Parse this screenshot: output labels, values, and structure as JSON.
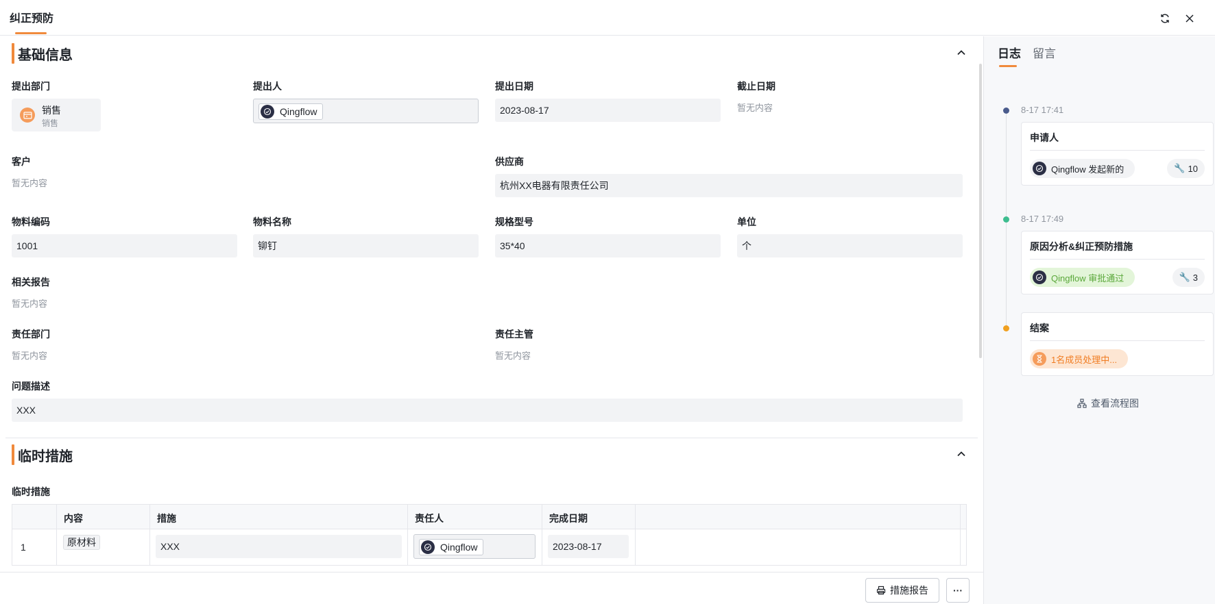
{
  "header": {
    "title": "纠正预防",
    "refresh_icon": "refresh-icon",
    "close_icon": "close-icon"
  },
  "sections": {
    "basic": {
      "title": "基础信息"
    },
    "temporary": {
      "title": "临时措施"
    }
  },
  "fields": {
    "dept": {
      "label": "提出部门",
      "name": "销售",
      "sub": "销售"
    },
    "proposer": {
      "label": "提出人",
      "value": "Qingflow"
    },
    "date": {
      "label": "提出日期",
      "value": "2023-08-17"
    },
    "deadline": {
      "label": "截止日期",
      "value": "暂无内容"
    },
    "customer": {
      "label": "客户",
      "value": "暂无内容"
    },
    "supplier": {
      "label": "供应商",
      "value": "杭州XX电器有限责任公司"
    },
    "material_code": {
      "label": "物料编码",
      "value": "1001"
    },
    "material_name": {
      "label": "物料名称",
      "value": "铆钉"
    },
    "spec": {
      "label": "规格型号",
      "value": "35*40"
    },
    "unit": {
      "label": "单位",
      "value": "个"
    },
    "report": {
      "label": "相关报告",
      "value": "暂无内容"
    },
    "resp_dept": {
      "label": "责任部门",
      "value": "暂无内容"
    },
    "resp_manager": {
      "label": "责任主管",
      "value": "暂无内容"
    },
    "problem": {
      "label": "问题描述",
      "value": "XXX"
    }
  },
  "measures_table": {
    "label": "临时措施",
    "headers": [
      "内容",
      "措施",
      "责任人",
      "完成日期"
    ],
    "rows": [
      {
        "index": "1",
        "content": "原材料",
        "measure": "XXX",
        "owner": "Qingflow",
        "date": "2023-08-17"
      }
    ]
  },
  "footer": {
    "report_button": "措施报告",
    "more_button": "···"
  },
  "right_panel": {
    "tabs": [
      "日志",
      "留言"
    ],
    "timeline": [
      {
        "time": "8-17 17:41",
        "title": "申请人",
        "actor": "Qingflow 发起新的",
        "count": "10",
        "dot_color": "#4a5b8c"
      },
      {
        "time": "8-17 17:49",
        "title": "原因分析&纠正预防措施",
        "actor": "Qingflow 审批通过",
        "count": "3",
        "dot_color": "#3dbd8f"
      },
      {
        "time": "",
        "title": "结案",
        "actor": "1名成员处理中...",
        "count": "",
        "dot_color": "#f0a020"
      }
    ],
    "flow_link": "查看流程图"
  },
  "colors": {
    "accent": "#f08a3c",
    "approved_bg": "#e3f5d9",
    "approved_text": "#5aa83a",
    "pending_bg": "#fde6d3",
    "pending_text": "#f07c22"
  }
}
